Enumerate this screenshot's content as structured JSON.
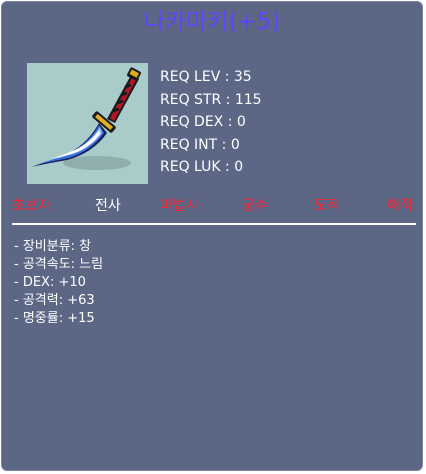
{
  "item": {
    "name": "나카마키(+5)",
    "icon": "katana-dagger-icon",
    "name_color": "#5c46ff"
  },
  "requirements": [
    "REQ LEV : 35",
    "REQ STR : 115",
    "REQ DEX : 0",
    "REQ INT : 0",
    "REQ LUK : 0"
  ],
  "jobs": [
    {
      "label": "초보자",
      "color": "#ff2233"
    },
    {
      "label": "전사",
      "color": "#ffffff"
    },
    {
      "label": "마법사",
      "color": "#ff2233"
    },
    {
      "label": "궁수",
      "color": "#ff2233"
    },
    {
      "label": "도적",
      "color": "#ff2233"
    },
    {
      "label": "해적",
      "color": "#ff2233"
    }
  ],
  "stats": [
    "- 장비분류: 창",
    "- 공격속도: 느림",
    "- DEX: +10",
    "- 공격력: +63",
    "- 명중률: +15"
  ],
  "colors": {
    "panel": "#5c6786",
    "icon_bg": "#a9cbc9"
  }
}
